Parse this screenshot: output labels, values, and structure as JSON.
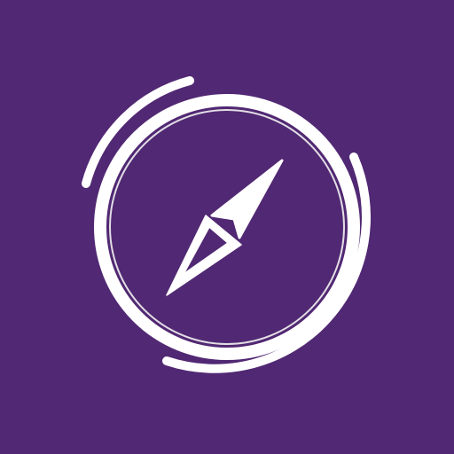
{
  "icon": {
    "name": "compass-icon",
    "background_color": "#512873",
    "foreground_color": "#FFFFFF"
  }
}
